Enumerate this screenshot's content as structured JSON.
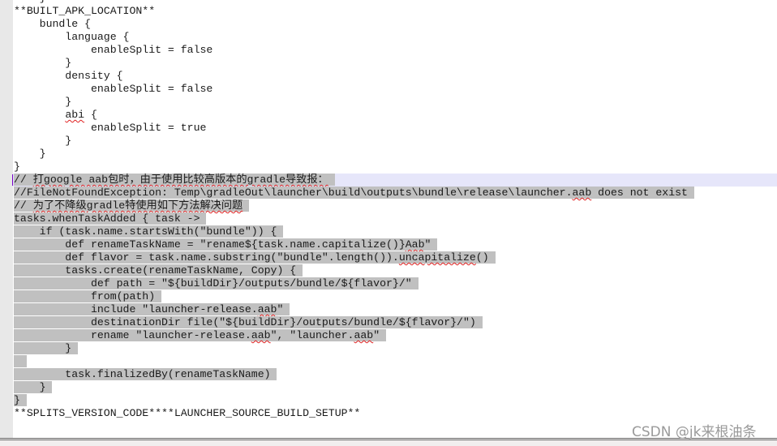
{
  "editor": {
    "lines": [
      {
        "text": "    }  ",
        "sel": false
      },
      {
        "text": "**BUILT_APK_LOCATION**",
        "sel": false
      },
      {
        "text": "    bundle {",
        "sel": false
      },
      {
        "text": "        language {",
        "sel": false
      },
      {
        "text": "            enableSplit = false",
        "sel": false
      },
      {
        "text": "        }",
        "sel": false
      },
      {
        "text": "        density {",
        "sel": false
      },
      {
        "text": "            enableSplit = false",
        "sel": false
      },
      {
        "text": "        }",
        "sel": false
      },
      {
        "text": "        abi {",
        "sel": false,
        "errs": [
          "abi"
        ]
      },
      {
        "text": "            enableSplit = true",
        "sel": false
      },
      {
        "text": "        }",
        "sel": false
      },
      {
        "text": "    }",
        "sel": false
      },
      {
        "text": "}",
        "sel": false
      },
      {
        "text": "// 打google aab包时，由于使用比较高版本的gradle导致报：",
        "sel": true,
        "current": true,
        "caret": true,
        "errs": [
          "打google aab包时，由于使用比较高版本的gradle导致报："
        ]
      },
      {
        "text": "//FileNotFoundException: Temp\\gradleOut\\launcher\\build\\outputs\\bundle\\release\\launcher.aab does not exist",
        "sel": true,
        "errs": [
          "aab"
        ]
      },
      {
        "text": "// 为了不降级gradle特使用如下方法解决问题",
        "sel": true,
        "errs": [
          "为了不降级gradle特使用如下方法解决问题"
        ]
      },
      {
        "text": "tasks.whenTaskAdded { task ->",
        "sel": true
      },
      {
        "text": "    if (task.name.startsWith(\"bundle\")) {",
        "sel": true
      },
      {
        "text": "        def renameTaskName = \"rename${task.name.capitalize()}Aab\"",
        "sel": true,
        "errs": [
          "Aab"
        ]
      },
      {
        "text": "        def flavor = task.name.substring(\"bundle\".length()).uncapitalize()",
        "sel": true,
        "errs": [
          "uncapitalize"
        ]
      },
      {
        "text": "        tasks.create(renameTaskName, Copy) {",
        "sel": true
      },
      {
        "text": "            def path = \"${buildDir}/outputs/bundle/${flavor}/\"",
        "sel": true
      },
      {
        "text": "            from(path)",
        "sel": true
      },
      {
        "text": "            include \"launcher-release.aab\"",
        "sel": true,
        "errs": [
          "aab"
        ]
      },
      {
        "text": "            destinationDir file(\"${buildDir}/outputs/bundle/${flavor}/\")",
        "sel": true
      },
      {
        "text": "            rename \"launcher-release.aab\", \"launcher.aab\"",
        "sel": true,
        "errs": [
          "aab"
        ]
      },
      {
        "text": "        }",
        "sel": true
      },
      {
        "text": " ",
        "sel": true
      },
      {
        "text": "        task.finalizedBy(renameTaskName)",
        "sel": true
      },
      {
        "text": "    }",
        "sel": true
      },
      {
        "text": "}",
        "sel": true
      },
      {
        "text": "**SPLITS_VERSION_CODE****LAUNCHER_SOURCE_BUILD_SETUP**",
        "sel": false
      }
    ]
  },
  "watermark": "CSDN @jk来根油条",
  "colors": {
    "selection": "#c0c0c0",
    "current_line": "#e6e6fa",
    "gutter": "#e8e8e8",
    "spell_error": "#e02020"
  }
}
